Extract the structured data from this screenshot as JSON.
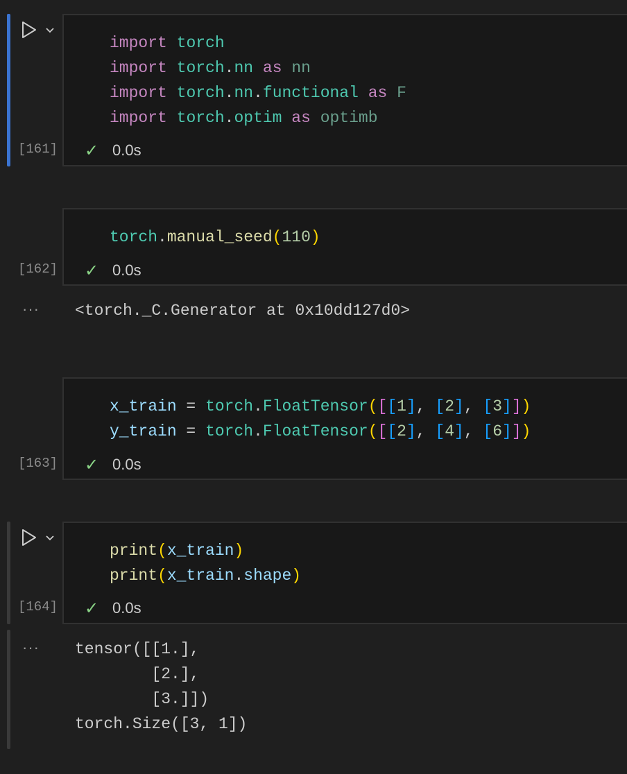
{
  "cells": [
    {
      "id": "cell-161",
      "exec_count": "[161]",
      "status_time": "0.0s",
      "code_lines": [
        [
          {
            "t": "import",
            "c": "kw"
          },
          {
            "t": " ",
            "c": "plain"
          },
          {
            "t": "torch",
            "c": "mod"
          }
        ],
        [
          {
            "t": "import",
            "c": "kw"
          },
          {
            "t": " ",
            "c": "plain"
          },
          {
            "t": "torch",
            "c": "mod"
          },
          {
            "t": ".",
            "c": "plain"
          },
          {
            "t": "nn",
            "c": "mod"
          },
          {
            "t": " ",
            "c": "plain"
          },
          {
            "t": "as",
            "c": "kw"
          },
          {
            "t": " ",
            "c": "plain"
          },
          {
            "t": "nn",
            "c": "dim"
          }
        ],
        [
          {
            "t": "import",
            "c": "kw"
          },
          {
            "t": " ",
            "c": "plain"
          },
          {
            "t": "torch",
            "c": "mod"
          },
          {
            "t": ".",
            "c": "plain"
          },
          {
            "t": "nn",
            "c": "mod"
          },
          {
            "t": ".",
            "c": "plain"
          },
          {
            "t": "functional",
            "c": "mod"
          },
          {
            "t": " ",
            "c": "plain"
          },
          {
            "t": "as",
            "c": "kw"
          },
          {
            "t": " ",
            "c": "plain"
          },
          {
            "t": "F",
            "c": "dim"
          }
        ],
        [
          {
            "t": "import",
            "c": "kw"
          },
          {
            "t": " ",
            "c": "plain"
          },
          {
            "t": "torch",
            "c": "mod"
          },
          {
            "t": ".",
            "c": "plain"
          },
          {
            "t": "optim",
            "c": "mod"
          },
          {
            "t": " ",
            "c": "plain"
          },
          {
            "t": "as",
            "c": "kw"
          },
          {
            "t": " ",
            "c": "plain"
          },
          {
            "t": "optimb",
            "c": "dim"
          }
        ]
      ]
    },
    {
      "id": "cell-162",
      "exec_count": "[162]",
      "status_time": "0.0s",
      "code_lines": [
        [
          {
            "t": "torch",
            "c": "mod"
          },
          {
            "t": ".",
            "c": "plain"
          },
          {
            "t": "manual_seed",
            "c": "fn"
          },
          {
            "t": "(",
            "c": "p1"
          },
          {
            "t": "110",
            "c": "num"
          },
          {
            "t": ")",
            "c": "p1"
          }
        ]
      ],
      "output_lines": [
        "<torch._C.Generator at 0x10dd127d0>"
      ]
    },
    {
      "id": "cell-163",
      "exec_count": "[163]",
      "status_time": "0.0s",
      "code_lines": [
        [
          {
            "t": "x_train",
            "c": "var"
          },
          {
            "t": " = ",
            "c": "plain"
          },
          {
            "t": "torch",
            "c": "mod"
          },
          {
            "t": ".",
            "c": "plain"
          },
          {
            "t": "FloatTensor",
            "c": "mod"
          },
          {
            "t": "(",
            "c": "p1"
          },
          {
            "t": "[",
            "c": "p2"
          },
          {
            "t": "[",
            "c": "p3"
          },
          {
            "t": "1",
            "c": "num"
          },
          {
            "t": "]",
            "c": "p3"
          },
          {
            "t": ", ",
            "c": "plain"
          },
          {
            "t": "[",
            "c": "p3"
          },
          {
            "t": "2",
            "c": "num"
          },
          {
            "t": "]",
            "c": "p3"
          },
          {
            "t": ", ",
            "c": "plain"
          },
          {
            "t": "[",
            "c": "p3"
          },
          {
            "t": "3",
            "c": "num"
          },
          {
            "t": "]",
            "c": "p3"
          },
          {
            "t": "]",
            "c": "p2"
          },
          {
            "t": ")",
            "c": "p1"
          }
        ],
        [
          {
            "t": "y_train",
            "c": "var"
          },
          {
            "t": " = ",
            "c": "plain"
          },
          {
            "t": "torch",
            "c": "mod"
          },
          {
            "t": ".",
            "c": "plain"
          },
          {
            "t": "FloatTensor",
            "c": "mod"
          },
          {
            "t": "(",
            "c": "p1"
          },
          {
            "t": "[",
            "c": "p2"
          },
          {
            "t": "[",
            "c": "p3"
          },
          {
            "t": "2",
            "c": "num"
          },
          {
            "t": "]",
            "c": "p3"
          },
          {
            "t": ", ",
            "c": "plain"
          },
          {
            "t": "[",
            "c": "p3"
          },
          {
            "t": "4",
            "c": "num"
          },
          {
            "t": "]",
            "c": "p3"
          },
          {
            "t": ", ",
            "c": "plain"
          },
          {
            "t": "[",
            "c": "p3"
          },
          {
            "t": "6",
            "c": "num"
          },
          {
            "t": "]",
            "c": "p3"
          },
          {
            "t": "]",
            "c": "p2"
          },
          {
            "t": ")",
            "c": "p1"
          }
        ]
      ]
    },
    {
      "id": "cell-164",
      "exec_count": "[164]",
      "status_time": "0.0s",
      "code_lines": [
        [
          {
            "t": "print",
            "c": "fn"
          },
          {
            "t": "(",
            "c": "p1"
          },
          {
            "t": "x_train",
            "c": "var"
          },
          {
            "t": ")",
            "c": "p1"
          }
        ],
        [
          {
            "t": "print",
            "c": "fn"
          },
          {
            "t": "(",
            "c": "p1"
          },
          {
            "t": "x_train",
            "c": "var"
          },
          {
            "t": ".",
            "c": "plain"
          },
          {
            "t": "shape",
            "c": "var"
          },
          {
            "t": ")",
            "c": "p1"
          }
        ]
      ],
      "output_lines": [
        "tensor([[1.],",
        "        [2.],",
        "        [3.]])",
        "torch.Size([3, 1])"
      ]
    }
  ],
  "icons": {
    "run": "run-cell-icon",
    "chevron": "chevron-down-icon",
    "check": "check-icon",
    "more": "more-actions-icon"
  },
  "glyphs": {
    "check": "✓",
    "more": "···"
  },
  "colors": {
    "background": "#1f1f1f",
    "cell_background": "#181818",
    "focus_bar": "#3b74d1",
    "success": "#89d185"
  }
}
